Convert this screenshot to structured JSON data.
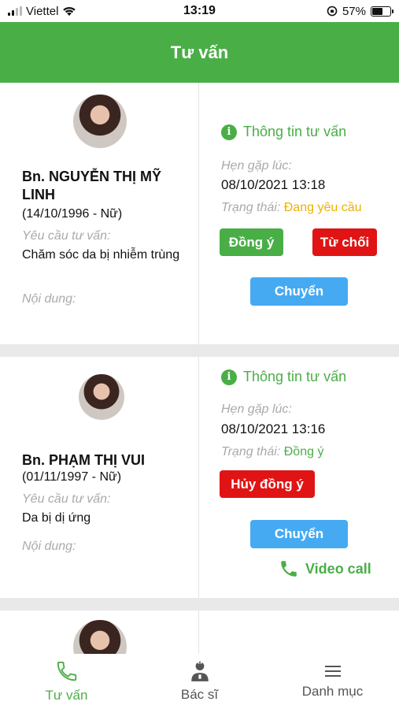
{
  "statusbar": {
    "carrier": "Viettel",
    "time": "13:19",
    "battery": "57%",
    "battery_level": 0.57
  },
  "header": {
    "title": "Tư vấn"
  },
  "cards": [
    {
      "patient_name": "Bn. NGUYỄN THỊ MỸ LINH",
      "birth": "(14/10/1996 - Nữ)",
      "request_label": "Yêu cầu tư vấn:",
      "request_value": "Chăm sóc da bị nhiễm trùng",
      "content_label": "Nội dung:",
      "info_title": "Thông tin tư vấn",
      "appointment_label": "Hẹn gặp lúc:",
      "appointment_value": "08/10/2021 13:18",
      "status_label": "Trạng thái:",
      "status_value": "Đang yêu cầu",
      "status_color": "#f0b000",
      "accept_label": "Đồng ý",
      "reject_label": "Từ chối",
      "transfer_label": "Chuyển"
    },
    {
      "patient_name": "Bn. PHẠM THỊ VUI",
      "birth": "(01/11/1997 - Nữ)",
      "request_label": "Yêu cầu tư vấn:",
      "request_value": "Da bị dị ứng",
      "content_label": "Nội dung:",
      "info_title": "Thông tin tư vấn",
      "appointment_label": "Hẹn gặp lúc:",
      "appointment_value": "08/10/2021 13:16",
      "status_label": "Trạng thái:",
      "status_value": "Đồng ý",
      "status_color": "#4aae47",
      "cancel_label": "Hủy đồng ý",
      "transfer_label": "Chuyển",
      "video_label": "Video call"
    }
  ],
  "bottom_nav": [
    {
      "label": "Tư vấn",
      "icon": "phone-icon",
      "active": true
    },
    {
      "label": "Bác sĩ",
      "icon": "doctor-icon",
      "active": false
    },
    {
      "label": "Danh mục",
      "icon": "menu-icon",
      "active": false
    }
  ],
  "colors": {
    "primary": "#4aae47",
    "danger": "#e01414",
    "info": "#45aaf2",
    "pending": "#f0b000"
  }
}
